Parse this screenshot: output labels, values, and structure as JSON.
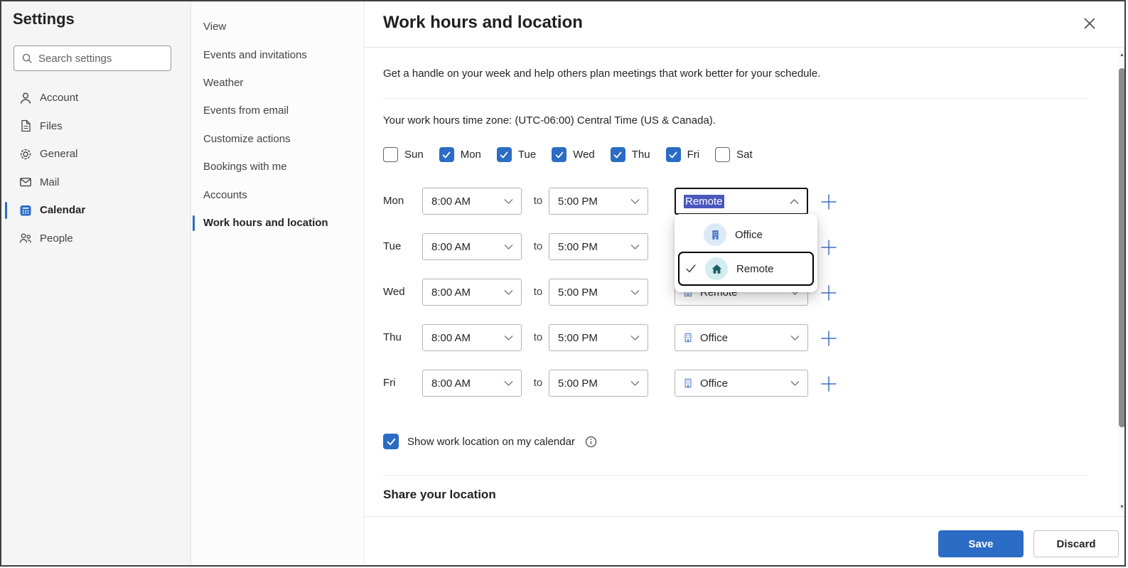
{
  "sidebar": {
    "title": "Settings",
    "search": {
      "placeholder": "Search settings"
    },
    "items": [
      {
        "label": "Account",
        "icon": "person-icon",
        "selected": false
      },
      {
        "label": "Files",
        "icon": "file-icon",
        "selected": false
      },
      {
        "label": "General",
        "icon": "gear-icon",
        "selected": false
      },
      {
        "label": "Mail",
        "icon": "mail-icon",
        "selected": false
      },
      {
        "label": "Calendar",
        "icon": "calendar-icon",
        "selected": true
      },
      {
        "label": "People",
        "icon": "people-icon",
        "selected": false
      }
    ]
  },
  "subnav": {
    "items": [
      {
        "label": "View",
        "selected": false
      },
      {
        "label": "Events and invitations",
        "selected": false
      },
      {
        "label": "Weather",
        "selected": false
      },
      {
        "label": "Events from email",
        "selected": false
      },
      {
        "label": "Customize actions",
        "selected": false
      },
      {
        "label": "Bookings with me",
        "selected": false
      },
      {
        "label": "Accounts",
        "selected": false
      },
      {
        "label": "Work hours and location",
        "selected": true
      }
    ]
  },
  "panel": {
    "title": "Work hours and location",
    "description": "Get a handle on your week and help others plan meetings that work better for your schedule.",
    "timezone_text": "Your work hours time zone: (UTC-06:00) Central Time (US & Canada).",
    "days": [
      {
        "label": "Sun",
        "checked": false
      },
      {
        "label": "Mon",
        "checked": true
      },
      {
        "label": "Tue",
        "checked": true
      },
      {
        "label": "Wed",
        "checked": true
      },
      {
        "label": "Thu",
        "checked": true
      },
      {
        "label": "Fri",
        "checked": true
      },
      {
        "label": "Sat",
        "checked": false
      }
    ],
    "to_label": "to",
    "rows": [
      {
        "day": "Mon",
        "start": "8:00 AM",
        "end": "5:00 PM",
        "location": "Remote",
        "state": "dropdown-open"
      },
      {
        "day": "Tue",
        "start": "8:00 AM",
        "end": "5:00 PM",
        "location": "",
        "state": "hidden-behind-menu"
      },
      {
        "day": "Wed",
        "start": "8:00 AM",
        "end": "5:00 PM",
        "location": "Remote",
        "state": "partially-covered"
      },
      {
        "day": "Thu",
        "start": "8:00 AM",
        "end": "5:00 PM",
        "location": "Office",
        "state": "normal"
      },
      {
        "day": "Fri",
        "start": "8:00 AM",
        "end": "5:00 PM",
        "location": "Office",
        "state": "normal"
      }
    ],
    "location_menu": {
      "options": [
        {
          "label": "Office",
          "icon": "building-icon",
          "selected": false
        },
        {
          "label": "Remote",
          "icon": "home-icon",
          "selected": true,
          "focused": true
        }
      ]
    },
    "show_location": {
      "label": "Show work location on my calendar",
      "checked": true
    },
    "share_heading": "Share your location"
  },
  "footer": {
    "save_label": "Save",
    "discard_label": "Discard"
  },
  "colors": {
    "accent": "#2b6cc4",
    "text_selection": "#4b58be",
    "office_icon_bg": "#dce9f7",
    "remote_icon_bg": "#d3edf0"
  }
}
